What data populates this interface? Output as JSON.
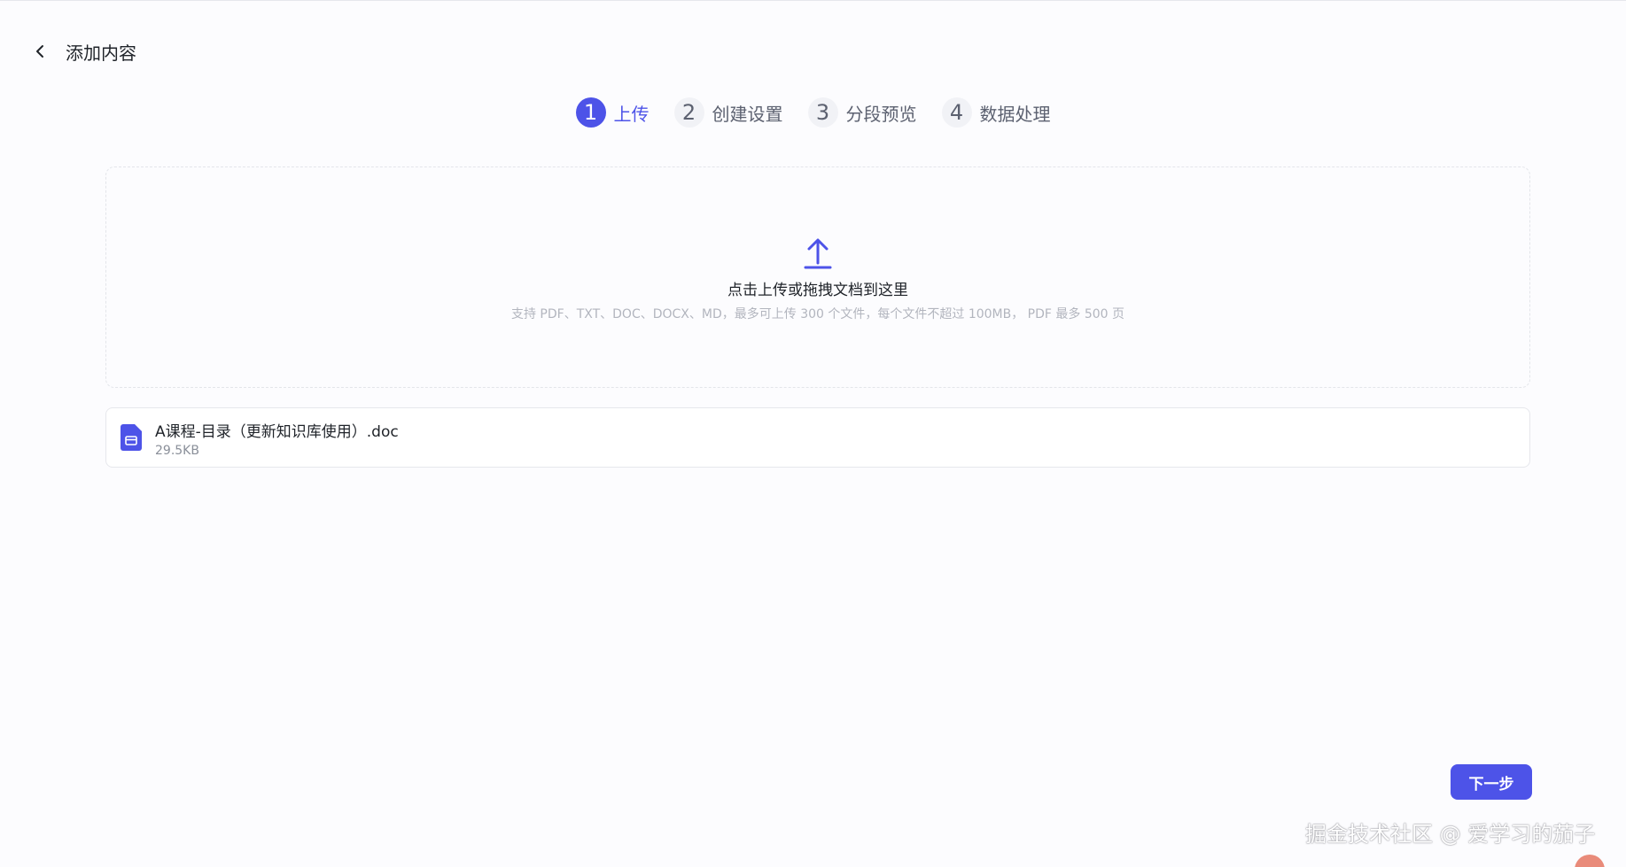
{
  "header": {
    "back_icon": "chevron-left-icon",
    "title": "添加内容"
  },
  "steps": [
    {
      "number": "1",
      "label": "上传",
      "active": true
    },
    {
      "number": "2",
      "label": "创建设置",
      "active": false
    },
    {
      "number": "3",
      "label": "分段预览",
      "active": false
    },
    {
      "number": "4",
      "label": "数据处理",
      "active": false
    }
  ],
  "dropzone": {
    "icon": "upload-icon",
    "title": "点击上传或拖拽文档到这里",
    "hint": "支持 PDF、TXT、DOC、DOCX、MD，最多可上传 300 个文件，每个文件不超过 100MB， PDF 最多 500 页"
  },
  "files": [
    {
      "icon": "document-icon",
      "name": "A课程-目录（更新知识库使用）.doc",
      "size": "29.5KB"
    }
  ],
  "footer": {
    "next_label": "下一步"
  },
  "watermark": "掘金技术社区 @ 爱学习的茄子",
  "colors": {
    "accent": "#4d53e8",
    "text_primary": "#1f2329",
    "text_secondary": "#5c6170",
    "hint": "#b2b5be",
    "border": "#e6e7ec"
  }
}
